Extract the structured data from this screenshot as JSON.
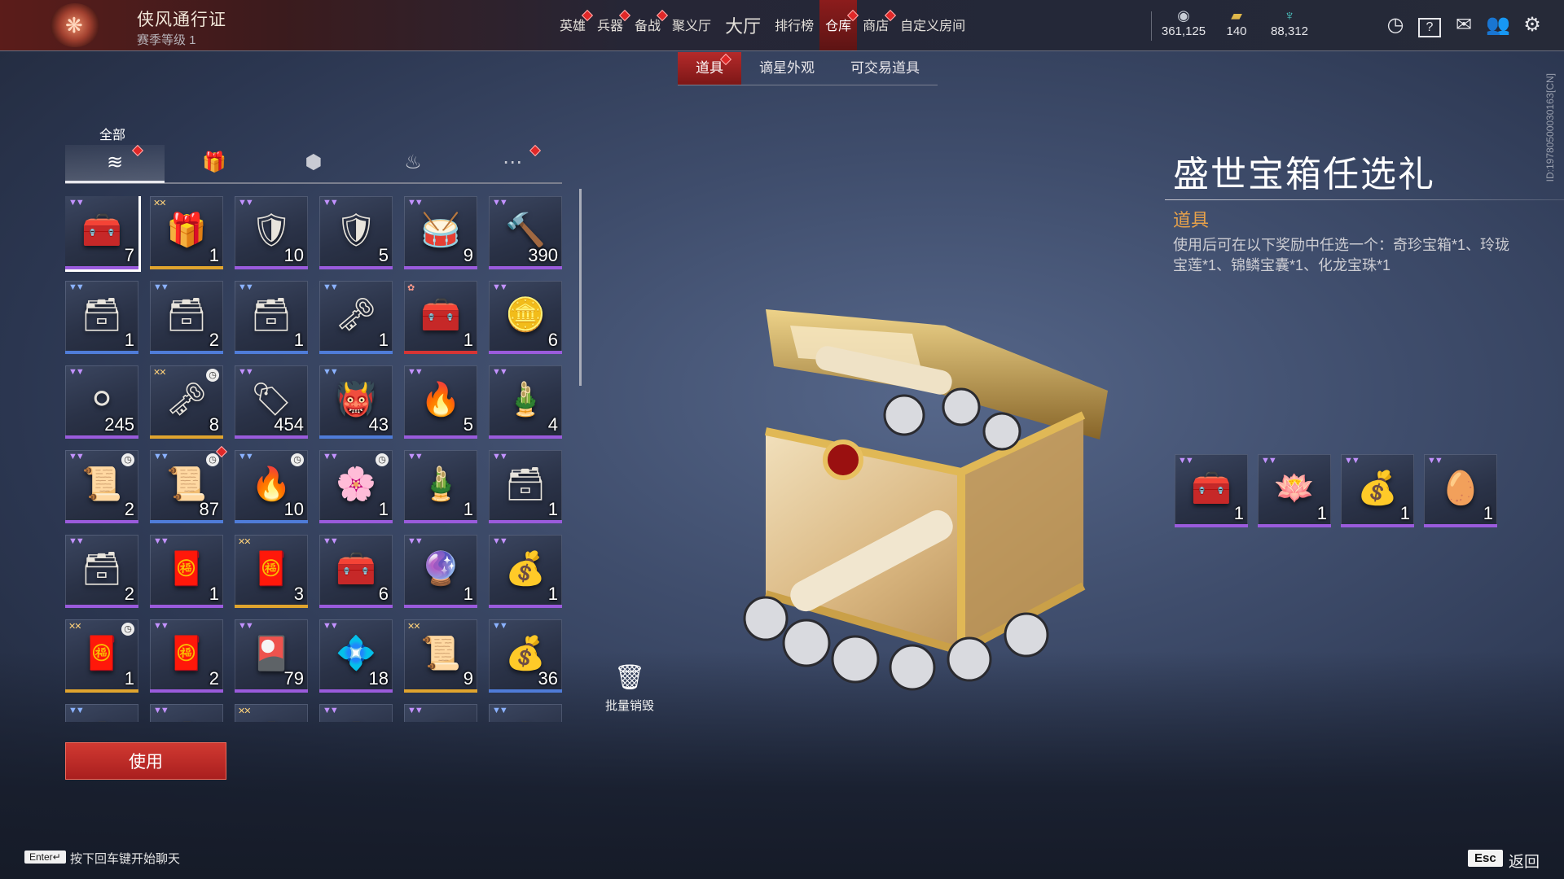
{
  "header": {
    "pass_title": "侠风通行证",
    "season_level": "赛季等级 1",
    "nav": [
      {
        "label": "英雄",
        "badge": true,
        "active": false,
        "big": false
      },
      {
        "label": "兵器",
        "badge": true,
        "active": false,
        "big": false
      },
      {
        "label": "备战",
        "badge": true,
        "active": false,
        "big": false
      },
      {
        "label": "聚义厅",
        "badge": false,
        "active": false,
        "big": false
      },
      {
        "label": "大厅",
        "badge": false,
        "active": false,
        "big": true
      },
      {
        "label": "排行榜",
        "badge": false,
        "active": false,
        "big": false
      },
      {
        "label": "仓库",
        "badge": true,
        "active": true,
        "big": false
      },
      {
        "label": "商店",
        "badge": true,
        "active": false,
        "big": false
      },
      {
        "label": "自定义房间",
        "badge": false,
        "active": false,
        "big": false
      }
    ],
    "currencies": [
      {
        "icon": "silver-coin-icon",
        "value": "361,125"
      },
      {
        "icon": "gold-ticket-icon",
        "value": "140"
      },
      {
        "icon": "jade-feather-icon",
        "value": "88,312"
      }
    ],
    "icons": [
      "history-icon",
      "help-icon",
      "mail-icon",
      "friends-icon",
      "settings-icon"
    ],
    "help_glyph": "?"
  },
  "subtabs": [
    {
      "label": "道具",
      "active": true,
      "badge": true
    },
    {
      "label": "谪星外观",
      "active": false,
      "badge": false
    },
    {
      "label": "可交易道具",
      "active": false,
      "badge": false
    }
  ],
  "inventory": {
    "category_label": "全部",
    "categories": [
      {
        "icon": "layers-icon",
        "active": true,
        "badge": true
      },
      {
        "icon": "gift-icon",
        "active": false,
        "badge": false
      },
      {
        "icon": "token-icon",
        "active": false,
        "badge": false
      },
      {
        "icon": "flame-icon",
        "active": false,
        "badge": false
      },
      {
        "icon": "more-icon",
        "active": false,
        "badge": true
      }
    ],
    "items": [
      {
        "count": "7",
        "rarity": "purple",
        "icon": "treasure-chest-icon",
        "selected": true
      },
      {
        "count": "1",
        "rarity": "gold",
        "icon": "gift-box-icon"
      },
      {
        "count": "10",
        "rarity": "purple",
        "icon": "purple-armor-icon"
      },
      {
        "count": "5",
        "rarity": "purple",
        "icon": "blue-armor-icon"
      },
      {
        "count": "9",
        "rarity": "purple",
        "icon": "drum-icon"
      },
      {
        "count": "390",
        "rarity": "purple",
        "icon": "hammer-icon"
      },
      {
        "count": "1",
        "rarity": "blue",
        "icon": "bronze-chest-icon"
      },
      {
        "count": "2",
        "rarity": "blue",
        "icon": "bronze-chest-icon"
      },
      {
        "count": "1",
        "rarity": "blue",
        "icon": "bronze-chest-icon"
      },
      {
        "count": "1",
        "rarity": "blue",
        "icon": "black-box-icon"
      },
      {
        "count": "1",
        "rarity": "red",
        "icon": "ornate-chest-icon"
      },
      {
        "count": "6",
        "rarity": "purple",
        "icon": "gold-coin-icon"
      },
      {
        "count": "245",
        "rarity": "purple",
        "icon": "pearl-icon"
      },
      {
        "count": "8",
        "rarity": "gold",
        "icon": "key-icon",
        "timed": true
      },
      {
        "count": "454",
        "rarity": "purple",
        "icon": "ancient-coin-icon"
      },
      {
        "count": "43",
        "rarity": "blue",
        "icon": "demon-mask-icon"
      },
      {
        "count": "5",
        "rarity": "purple",
        "icon": "fire-gem-icon"
      },
      {
        "count": "4",
        "rarity": "purple",
        "icon": "bamboo-gift-icon"
      },
      {
        "count": "2",
        "rarity": "purple",
        "icon": "scroll-case-icon",
        "timed": true
      },
      {
        "count": "87",
        "rarity": "blue",
        "icon": "flame-scroll-icon",
        "timed": true,
        "badge": true
      },
      {
        "count": "10",
        "rarity": "blue",
        "icon": "fire-cauldron-icon",
        "timed": true
      },
      {
        "count": "1",
        "rarity": "purple",
        "icon": "flower-icon",
        "timed": true
      },
      {
        "count": "1",
        "rarity": "purple",
        "icon": "bamboo-gift-icon"
      },
      {
        "count": "1",
        "rarity": "purple",
        "icon": "jade-chest-icon"
      },
      {
        "count": "2",
        "rarity": "purple",
        "icon": "jade-chest-icon"
      },
      {
        "count": "1",
        "rarity": "purple",
        "icon": "red-chest-icon"
      },
      {
        "count": "3",
        "rarity": "gold",
        "icon": "red-chest-icon"
      },
      {
        "count": "6",
        "rarity": "purple",
        "icon": "treasure-chest-icon"
      },
      {
        "count": "1",
        "rarity": "purple",
        "icon": "crystal-staff-icon"
      },
      {
        "count": "1",
        "rarity": "purple",
        "icon": "silver-pouch-icon"
      },
      {
        "count": "1",
        "rarity": "gold",
        "icon": "red-envelope-icon",
        "timed": true
      },
      {
        "count": "2",
        "rarity": "purple",
        "icon": "red-chest-icon"
      },
      {
        "count": "79",
        "rarity": "purple",
        "icon": "talisman-card-icon"
      },
      {
        "count": "18",
        "rarity": "purple",
        "icon": "jade-ingot-icon"
      },
      {
        "count": "9",
        "rarity": "gold",
        "icon": "scroll-icon"
      },
      {
        "count": "36",
        "rarity": "blue",
        "icon": "lucky-bag-icon"
      },
      {
        "count": "",
        "rarity": "blue",
        "icon": "chest-icon"
      },
      {
        "count": "",
        "rarity": "purple",
        "icon": "chest-icon"
      },
      {
        "count": "",
        "rarity": "gold",
        "icon": "chest-icon"
      },
      {
        "count": "",
        "rarity": "purple",
        "icon": "chest-icon"
      },
      {
        "count": "",
        "rarity": "purple",
        "icon": "chest-icon"
      },
      {
        "count": "",
        "rarity": "blue",
        "icon": "chest-icon"
      }
    ],
    "bulk_destroy_label": "批量销毁",
    "use_button": "使用"
  },
  "detail": {
    "title": "盛世宝箱任选礼",
    "category": "道具",
    "description": "使用后可在以下奖励中任选一个：奇珍宝箱*1、玲珑宝莲*1、锦鳞宝囊*1、化龙宝珠*1",
    "rewards": [
      {
        "icon": "rare-chest-icon",
        "count": "1",
        "rarity": "purple"
      },
      {
        "icon": "lotus-icon",
        "count": "1",
        "rarity": "purple"
      },
      {
        "icon": "treasure-pouch-icon",
        "count": "1",
        "rarity": "purple"
      },
      {
        "icon": "dragon-pearl-icon",
        "count": "1",
        "rarity": "purple"
      }
    ]
  },
  "side_id": "ID:1978050003016З[CN]",
  "footer": {
    "enter_key": "Enter↵",
    "chat_hint": "按下回车键开始聊天",
    "esc_key": "Esc",
    "back_label": "返回"
  },
  "colors": {
    "accent_red": "#b52a2a",
    "purple_rarity": "#9a5bdc",
    "blue_rarity": "#4f7cd8",
    "gold_rarity": "#e0a42e",
    "red_rarity": "#d63434",
    "detail_category": "#e8a24a"
  }
}
